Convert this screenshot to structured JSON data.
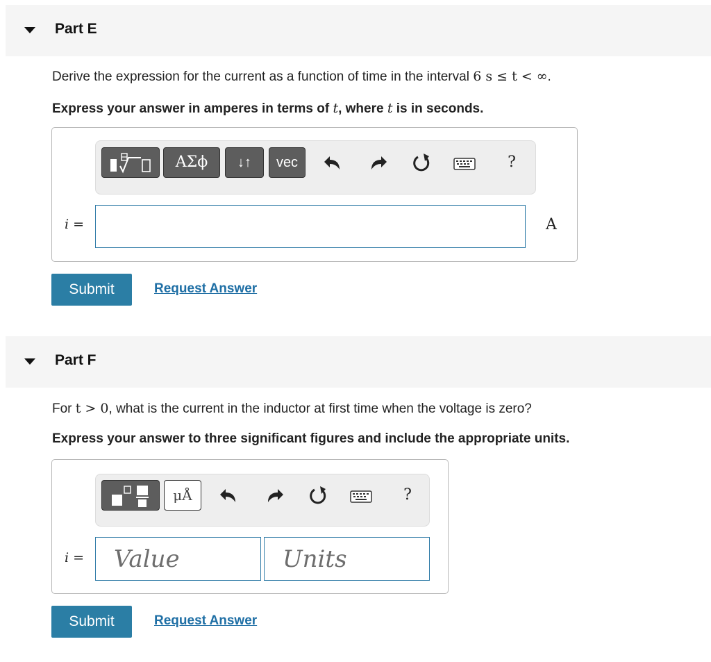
{
  "partE": {
    "title": "Part E",
    "question_text": "Derive the expression for the current as a function of time in the interval ",
    "question_math": "6 s ≤ t < ∞",
    "question_end": ".",
    "instruction_pre": "Express your answer in amperes in terms of ",
    "instruction_var": "t",
    "instruction_mid": ", where ",
    "instruction_var2": "t",
    "instruction_post": " is in seconds.",
    "toolbar": {
      "greek_label": "ΑΣϕ",
      "arrows_label": "↓↑",
      "vec_label": "vec",
      "help_label": "?"
    },
    "variable_label": "i =",
    "input_value": "",
    "unit": "A",
    "submit_label": "Submit",
    "request_label": "Request Answer"
  },
  "partF": {
    "title": "Part F",
    "question_pre": "For ",
    "question_math": "t > 0",
    "question_post": ", what is the current in the inductor at first time when the voltage is zero?",
    "instruction": "Express your answer to three significant figures and include the appropriate units.",
    "toolbar": {
      "units_label": "μÅ",
      "help_label": "?"
    },
    "variable_label": "i =",
    "value_placeholder": "Value",
    "units_placeholder": "Units",
    "submit_label": "Submit",
    "request_label": "Request Answer"
  },
  "colors": {
    "accent": "#2b7ea5",
    "link": "#1f6fa5",
    "field_border": "#2f7ba7",
    "header_bg": "#f5f5f5"
  },
  "icons": [
    "collapse-caret-icon",
    "templates-icon",
    "undo-icon",
    "redo-icon",
    "reset-icon",
    "keyboard-icon"
  ]
}
